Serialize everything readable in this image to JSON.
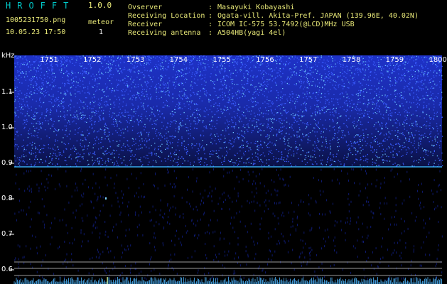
{
  "app": {
    "title": "HROFFT",
    "version": "1.0.0"
  },
  "file": {
    "name": "1005231750.png",
    "datetime": "10.05.23 17:50"
  },
  "meteor": {
    "label": "meteor",
    "count": "1"
  },
  "info": [
    {
      "label": "Ovserver",
      "value": "Masayuki Kobayashi"
    },
    {
      "label": "Receiving Location",
      "value": "Ogata-vill. Akita-Pref. JAPAN (139.96E, 40.02N)"
    },
    {
      "label": "Receiver",
      "value": "ICOM IC-575 53.7492(@LCD)MHz USB"
    },
    {
      "label": "Receiving antenna",
      "value": "A504HB(yagi 4el)"
    }
  ],
  "info_separator": ":",
  "chart_data": {
    "type": "heatmap",
    "ylabel": "kHz",
    "yticks": [
      "1.1",
      "1.0",
      "0.9",
      "0.8",
      "0.7",
      "0.6"
    ],
    "xticks": [
      "1751",
      "1752",
      "1753",
      "1754",
      "1755",
      "1756",
      "1757",
      "1758",
      "1759",
      "1800"
    ],
    "carrier_khz": 0.89,
    "meteor_echo": {
      "time": "1751",
      "khz": 0.8
    },
    "colors": {
      "background": "#000000",
      "noise": "#1e32c8",
      "carrier": "#3ab0ff",
      "grid": "#9a9a9a"
    }
  }
}
